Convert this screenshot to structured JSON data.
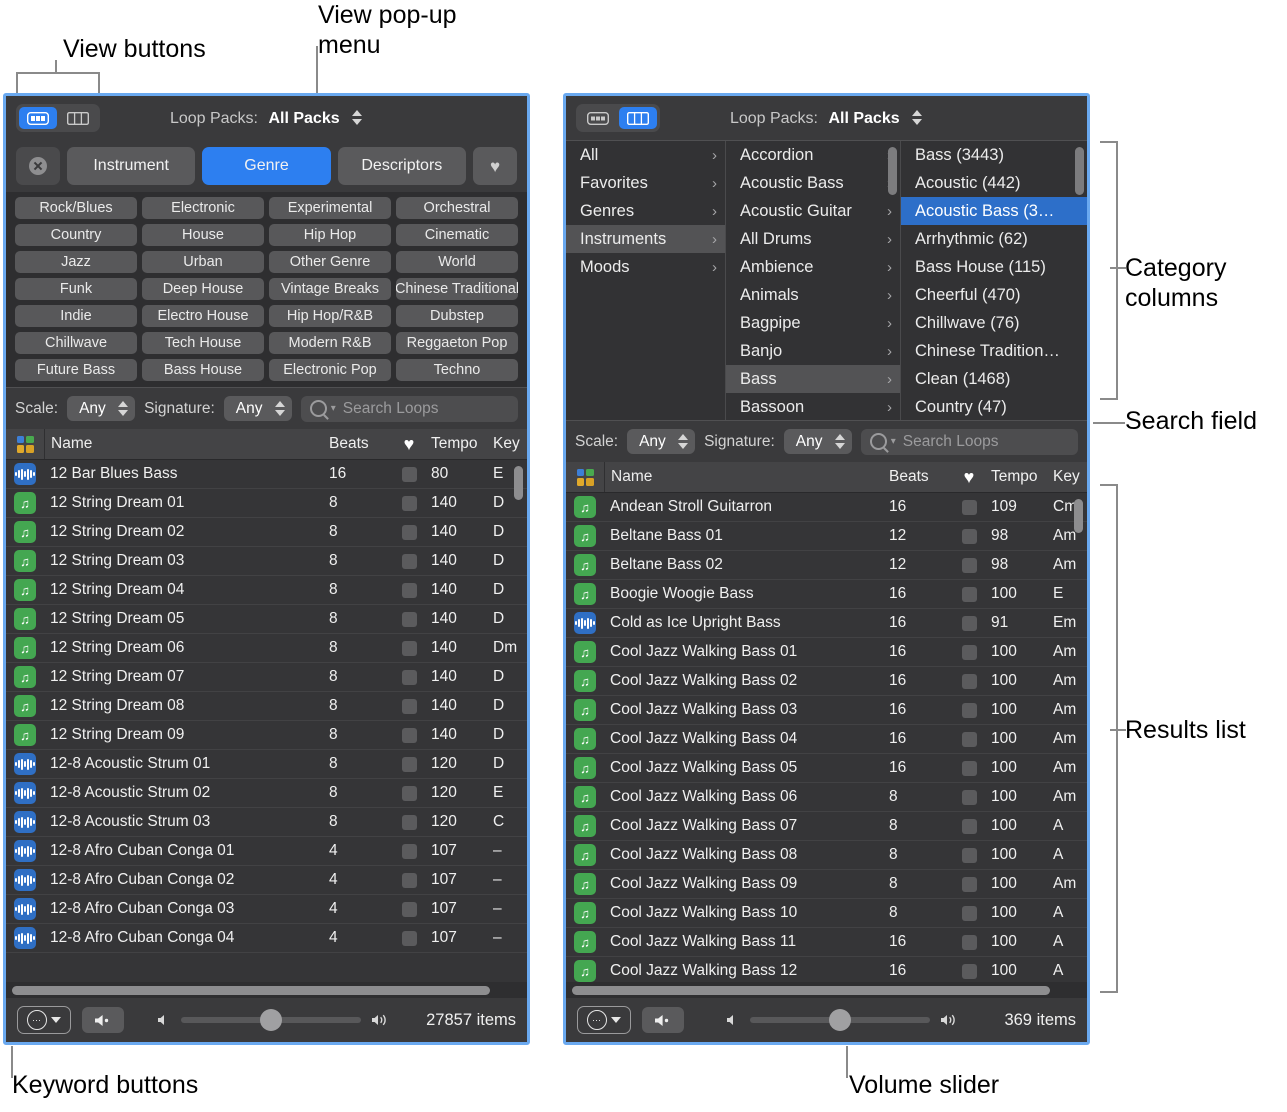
{
  "annotations": [
    {
      "id": "view-buttons",
      "text": "View buttons"
    },
    {
      "id": "view-popup-menu",
      "text": "View pop-up\nmenu"
    },
    {
      "id": "category-columns",
      "text": "Category\ncolumns"
    },
    {
      "id": "search-field",
      "text": "Search field"
    },
    {
      "id": "results-list",
      "text": "Results list"
    },
    {
      "id": "keyword-buttons",
      "text": "Keyword buttons"
    },
    {
      "id": "volume-slider",
      "text": "Volume slider"
    }
  ],
  "colors": {
    "accent_blue": "#2d7ff0",
    "window_border": "#6aa9f0",
    "panel_bg": "#3a3a3c",
    "list_bg": "#353537",
    "loop_green": "#44a751",
    "loop_blue": "#2f6fc4"
  },
  "left_panel": {
    "view_buttons": [
      {
        "name": "button-view",
        "icon": "button-view-icon",
        "selected": true
      },
      {
        "name": "column-view",
        "icon": "column-view-icon",
        "selected": false
      }
    ],
    "loop_packs_label": "Loop Packs:",
    "loop_packs_value": "All Packs",
    "category_buttons": [
      {
        "label": "",
        "icon": "reset-icon",
        "selected": false
      },
      {
        "label": "Instrument",
        "selected": false
      },
      {
        "label": "Genre",
        "selected": true
      },
      {
        "label": "Descriptors",
        "selected": false
      },
      {
        "label": "",
        "icon": "heart-icon",
        "selected": false
      }
    ],
    "keyword_buttons": [
      "Rock/Blues",
      "Electronic",
      "Experimental",
      "Orchestral",
      "Country",
      "House",
      "Hip Hop",
      "Cinematic",
      "Jazz",
      "Urban",
      "Other Genre",
      "World",
      "Funk",
      "Deep House",
      "Vintage Breaks",
      "Chinese Traditional",
      "Indie",
      "Electro House",
      "Hip Hop/R&B",
      "Dubstep",
      "Chillwave",
      "Tech House",
      "Modern R&B",
      "Reggaeton Pop",
      "Future Bass",
      "Bass House",
      "Electronic Pop",
      "Techno"
    ],
    "filters": {
      "scale_label": "Scale:",
      "scale_value": "Any",
      "signature_label": "Signature:",
      "signature_value": "Any",
      "search_placeholder": "Search Loops",
      "search_value": ""
    },
    "table": {
      "headers": {
        "icon": "",
        "name": "Name",
        "beats": "Beats",
        "fav": "",
        "tempo": "Tempo",
        "key": "Key"
      },
      "rows": [
        {
          "icon": "blue",
          "name": "12 Bar Blues Bass",
          "beats": "16",
          "tempo": "80",
          "key": "E"
        },
        {
          "icon": "green",
          "name": "12 String Dream 01",
          "beats": "8",
          "tempo": "140",
          "key": "D"
        },
        {
          "icon": "green",
          "name": "12 String Dream 02",
          "beats": "8",
          "tempo": "140",
          "key": "D"
        },
        {
          "icon": "green",
          "name": "12 String Dream 03",
          "beats": "8",
          "tempo": "140",
          "key": "D"
        },
        {
          "icon": "green",
          "name": "12 String Dream 04",
          "beats": "8",
          "tempo": "140",
          "key": "D"
        },
        {
          "icon": "green",
          "name": "12 String Dream 05",
          "beats": "8",
          "tempo": "140",
          "key": "D"
        },
        {
          "icon": "green",
          "name": "12 String Dream 06",
          "beats": "8",
          "tempo": "140",
          "key": "Dm"
        },
        {
          "icon": "green",
          "name": "12 String Dream 07",
          "beats": "8",
          "tempo": "140",
          "key": "D"
        },
        {
          "icon": "green",
          "name": "12 String Dream 08",
          "beats": "8",
          "tempo": "140",
          "key": "D"
        },
        {
          "icon": "green",
          "name": "12 String Dream 09",
          "beats": "8",
          "tempo": "140",
          "key": "D"
        },
        {
          "icon": "blue",
          "name": "12-8 Acoustic Strum 01",
          "beats": "8",
          "tempo": "120",
          "key": "D"
        },
        {
          "icon": "blue",
          "name": "12-8 Acoustic Strum 02",
          "beats": "8",
          "tempo": "120",
          "key": "E"
        },
        {
          "icon": "blue",
          "name": "12-8 Acoustic Strum 03",
          "beats": "8",
          "tempo": "120",
          "key": "C"
        },
        {
          "icon": "blue",
          "name": "12-8 Afro Cuban Conga 01",
          "beats": "4",
          "tempo": "107",
          "key": "–"
        },
        {
          "icon": "blue",
          "name": "12-8 Afro Cuban Conga 02",
          "beats": "4",
          "tempo": "107",
          "key": "–"
        },
        {
          "icon": "blue",
          "name": "12-8 Afro Cuban Conga 03",
          "beats": "4",
          "tempo": "107",
          "key": "–"
        },
        {
          "icon": "blue",
          "name": "12-8 Afro Cuban Conga 04",
          "beats": "4",
          "tempo": "107",
          "key": "–"
        }
      ]
    },
    "bottom": {
      "items_count": "27857 items"
    }
  },
  "right_panel": {
    "view_buttons": [
      {
        "name": "button-view",
        "icon": "button-view-icon",
        "selected": false
      },
      {
        "name": "column-view",
        "icon": "column-view-icon",
        "selected": true
      }
    ],
    "loop_packs_label": "Loop Packs:",
    "loop_packs_value": "All Packs",
    "columns": {
      "col1": [
        {
          "label": "All",
          "chevron": true,
          "state": "normal"
        },
        {
          "label": "Favorites",
          "chevron": true,
          "state": "normal"
        },
        {
          "label": "Genres",
          "chevron": true,
          "state": "normal"
        },
        {
          "label": "Instruments",
          "chevron": true,
          "state": "highlight"
        },
        {
          "label": "Moods",
          "chevron": true,
          "state": "normal"
        }
      ],
      "col2": [
        {
          "label": "Accordion",
          "chevron": true,
          "state": "normal"
        },
        {
          "label": "Acoustic Bass",
          "chevron": true,
          "state": "normal"
        },
        {
          "label": "Acoustic Guitar",
          "chevron": true,
          "state": "normal"
        },
        {
          "label": "All Drums",
          "chevron": true,
          "state": "normal"
        },
        {
          "label": "Ambience",
          "chevron": true,
          "state": "normal"
        },
        {
          "label": "Animals",
          "chevron": true,
          "state": "normal"
        },
        {
          "label": "Bagpipe",
          "chevron": true,
          "state": "normal"
        },
        {
          "label": "Banjo",
          "chevron": true,
          "state": "normal"
        },
        {
          "label": "Bass",
          "chevron": true,
          "state": "highlight"
        },
        {
          "label": "Bassoon",
          "chevron": true,
          "state": "normal"
        }
      ],
      "col3": [
        {
          "label": "Bass (3443)",
          "chevron": false,
          "state": "normal"
        },
        {
          "label": "Acoustic (442)",
          "chevron": false,
          "state": "normal"
        },
        {
          "label": "Acoustic Bass (3…",
          "chevron": false,
          "state": "selected"
        },
        {
          "label": "Arrhythmic (62)",
          "chevron": false,
          "state": "normal"
        },
        {
          "label": "Bass House (115)",
          "chevron": false,
          "state": "normal"
        },
        {
          "label": "Cheerful (470)",
          "chevron": false,
          "state": "normal"
        },
        {
          "label": "Chillwave (76)",
          "chevron": false,
          "state": "normal"
        },
        {
          "label": "Chinese Tradition…",
          "chevron": false,
          "state": "normal"
        },
        {
          "label": "Clean (1468)",
          "chevron": false,
          "state": "normal"
        },
        {
          "label": "Country (47)",
          "chevron": false,
          "state": "normal"
        }
      ]
    },
    "filters": {
      "scale_label": "Scale:",
      "scale_value": "Any",
      "signature_label": "Signature:",
      "signature_value": "Any",
      "search_placeholder": "Search Loops",
      "search_value": ""
    },
    "table": {
      "headers": {
        "icon": "",
        "name": "Name",
        "beats": "Beats",
        "fav": "",
        "tempo": "Tempo",
        "key": "Key"
      },
      "rows": [
        {
          "icon": "green",
          "name": "Andean Stroll Guitarron",
          "beats": "16",
          "tempo": "109",
          "key": "Cm"
        },
        {
          "icon": "green",
          "name": "Beltane Bass 01",
          "beats": "12",
          "tempo": "98",
          "key": "Am"
        },
        {
          "icon": "green",
          "name": "Beltane Bass 02",
          "beats": "12",
          "tempo": "98",
          "key": "Am"
        },
        {
          "icon": "green",
          "name": "Boogie Woogie Bass",
          "beats": "16",
          "tempo": "100",
          "key": "E"
        },
        {
          "icon": "blue",
          "name": "Cold as Ice Upright Bass",
          "beats": "16",
          "tempo": "91",
          "key": "Em"
        },
        {
          "icon": "green",
          "name": "Cool Jazz Walking Bass 01",
          "beats": "16",
          "tempo": "100",
          "key": "Am"
        },
        {
          "icon": "green",
          "name": "Cool Jazz Walking Bass 02",
          "beats": "16",
          "tempo": "100",
          "key": "Am"
        },
        {
          "icon": "green",
          "name": "Cool Jazz Walking Bass 03",
          "beats": "16",
          "tempo": "100",
          "key": "Am"
        },
        {
          "icon": "green",
          "name": "Cool Jazz Walking Bass 04",
          "beats": "16",
          "tempo": "100",
          "key": "Am"
        },
        {
          "icon": "green",
          "name": "Cool Jazz Walking Bass 05",
          "beats": "16",
          "tempo": "100",
          "key": "Am"
        },
        {
          "icon": "green",
          "name": "Cool Jazz Walking Bass 06",
          "beats": "8",
          "tempo": "100",
          "key": "Am"
        },
        {
          "icon": "green",
          "name": "Cool Jazz Walking Bass 07",
          "beats": "8",
          "tempo": "100",
          "key": "A"
        },
        {
          "icon": "green",
          "name": "Cool Jazz Walking Bass 08",
          "beats": "8",
          "tempo": "100",
          "key": "A"
        },
        {
          "icon": "green",
          "name": "Cool Jazz Walking Bass 09",
          "beats": "8",
          "tempo": "100",
          "key": "Am"
        },
        {
          "icon": "green",
          "name": "Cool Jazz Walking Bass 10",
          "beats": "8",
          "tempo": "100",
          "key": "A"
        },
        {
          "icon": "green",
          "name": "Cool Jazz Walking Bass 11",
          "beats": "16",
          "tempo": "100",
          "key": "A"
        },
        {
          "icon": "green",
          "name": "Cool Jazz Walking Bass 12",
          "beats": "16",
          "tempo": "100",
          "key": "A"
        }
      ]
    },
    "bottom": {
      "items_count": "369 items"
    }
  }
}
